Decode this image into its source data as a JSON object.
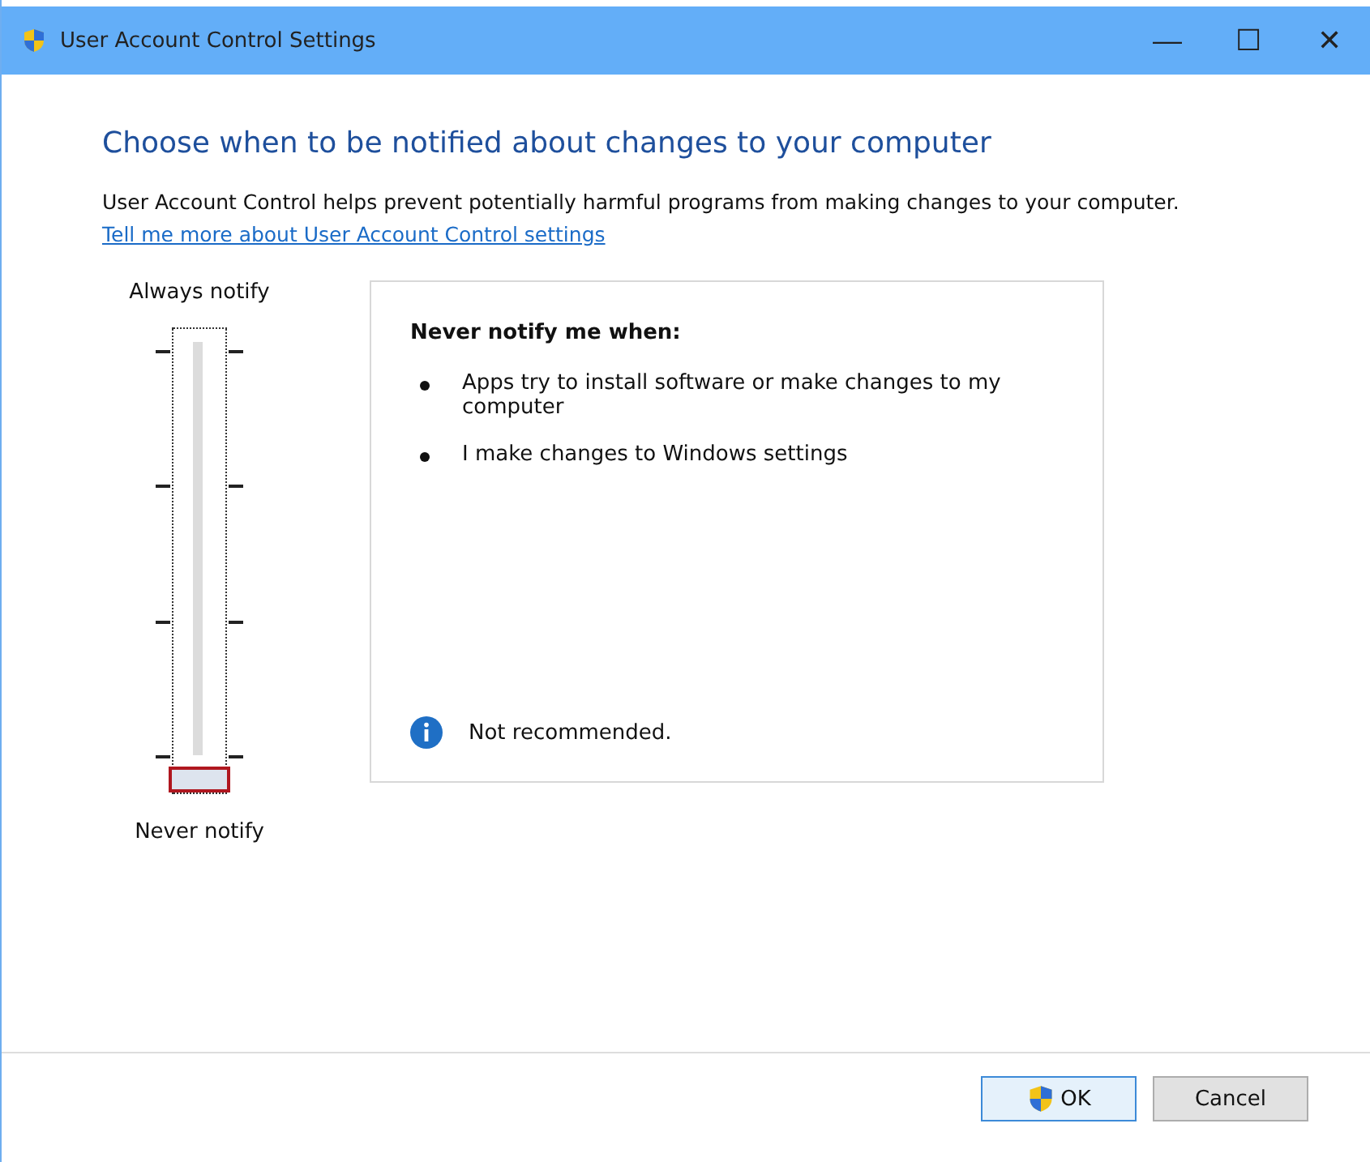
{
  "window": {
    "title": "User Account Control Settings",
    "controls": [
      "—",
      "☐",
      "✕"
    ]
  },
  "heading": "Choose when to be notified about changes to your computer",
  "description": "User Account Control helps prevent potentially harmful programs from making changes to your computer.",
  "link": "Tell me more about User Account Control settings",
  "slider": {
    "top_label": "Always notify",
    "bottom_label": "Never notify",
    "level": 0
  },
  "info": {
    "title": "Never notify me when:",
    "bullets": [
      "Apps try to install software or make changes to my computer",
      "I make changes to Windows settings"
    ],
    "note": "Not recommended."
  },
  "buttons": [
    {
      "label": "OK",
      "kind": "shield"
    },
    {
      "label": "Cancel",
      "kind": "plain"
    }
  ]
}
